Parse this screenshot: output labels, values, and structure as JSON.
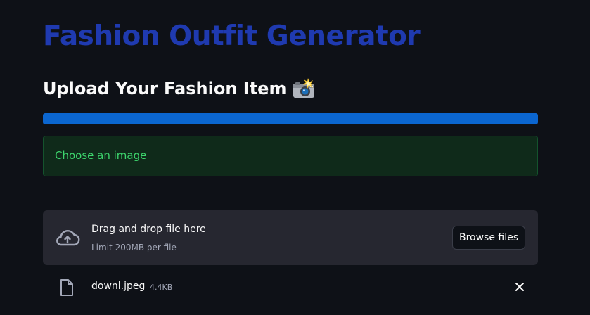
{
  "app": {
    "title": "Fashion Outfit Generator"
  },
  "upload_section": {
    "heading": "Upload Your Fashion Item",
    "heading_emoji": "camera-with-flash-icon",
    "progress": 1.0,
    "colors": {
      "title": "#1f3ab0",
      "progress_fill": "#0b66d0",
      "success_text": "#3dd56d",
      "success_bg": "#0f2a1a"
    }
  },
  "alert": {
    "message": "Choose an image"
  },
  "file_uploader": {
    "instructions": "Drag and drop file here",
    "limit": "Limit 200MB per file",
    "browse_label": "Browse files",
    "icon": "cloud-upload-icon"
  },
  "uploaded_file": {
    "name": "downl.jpeg",
    "size": "4.4KB",
    "icon": "file-icon",
    "remove_icon": "close-icon"
  }
}
